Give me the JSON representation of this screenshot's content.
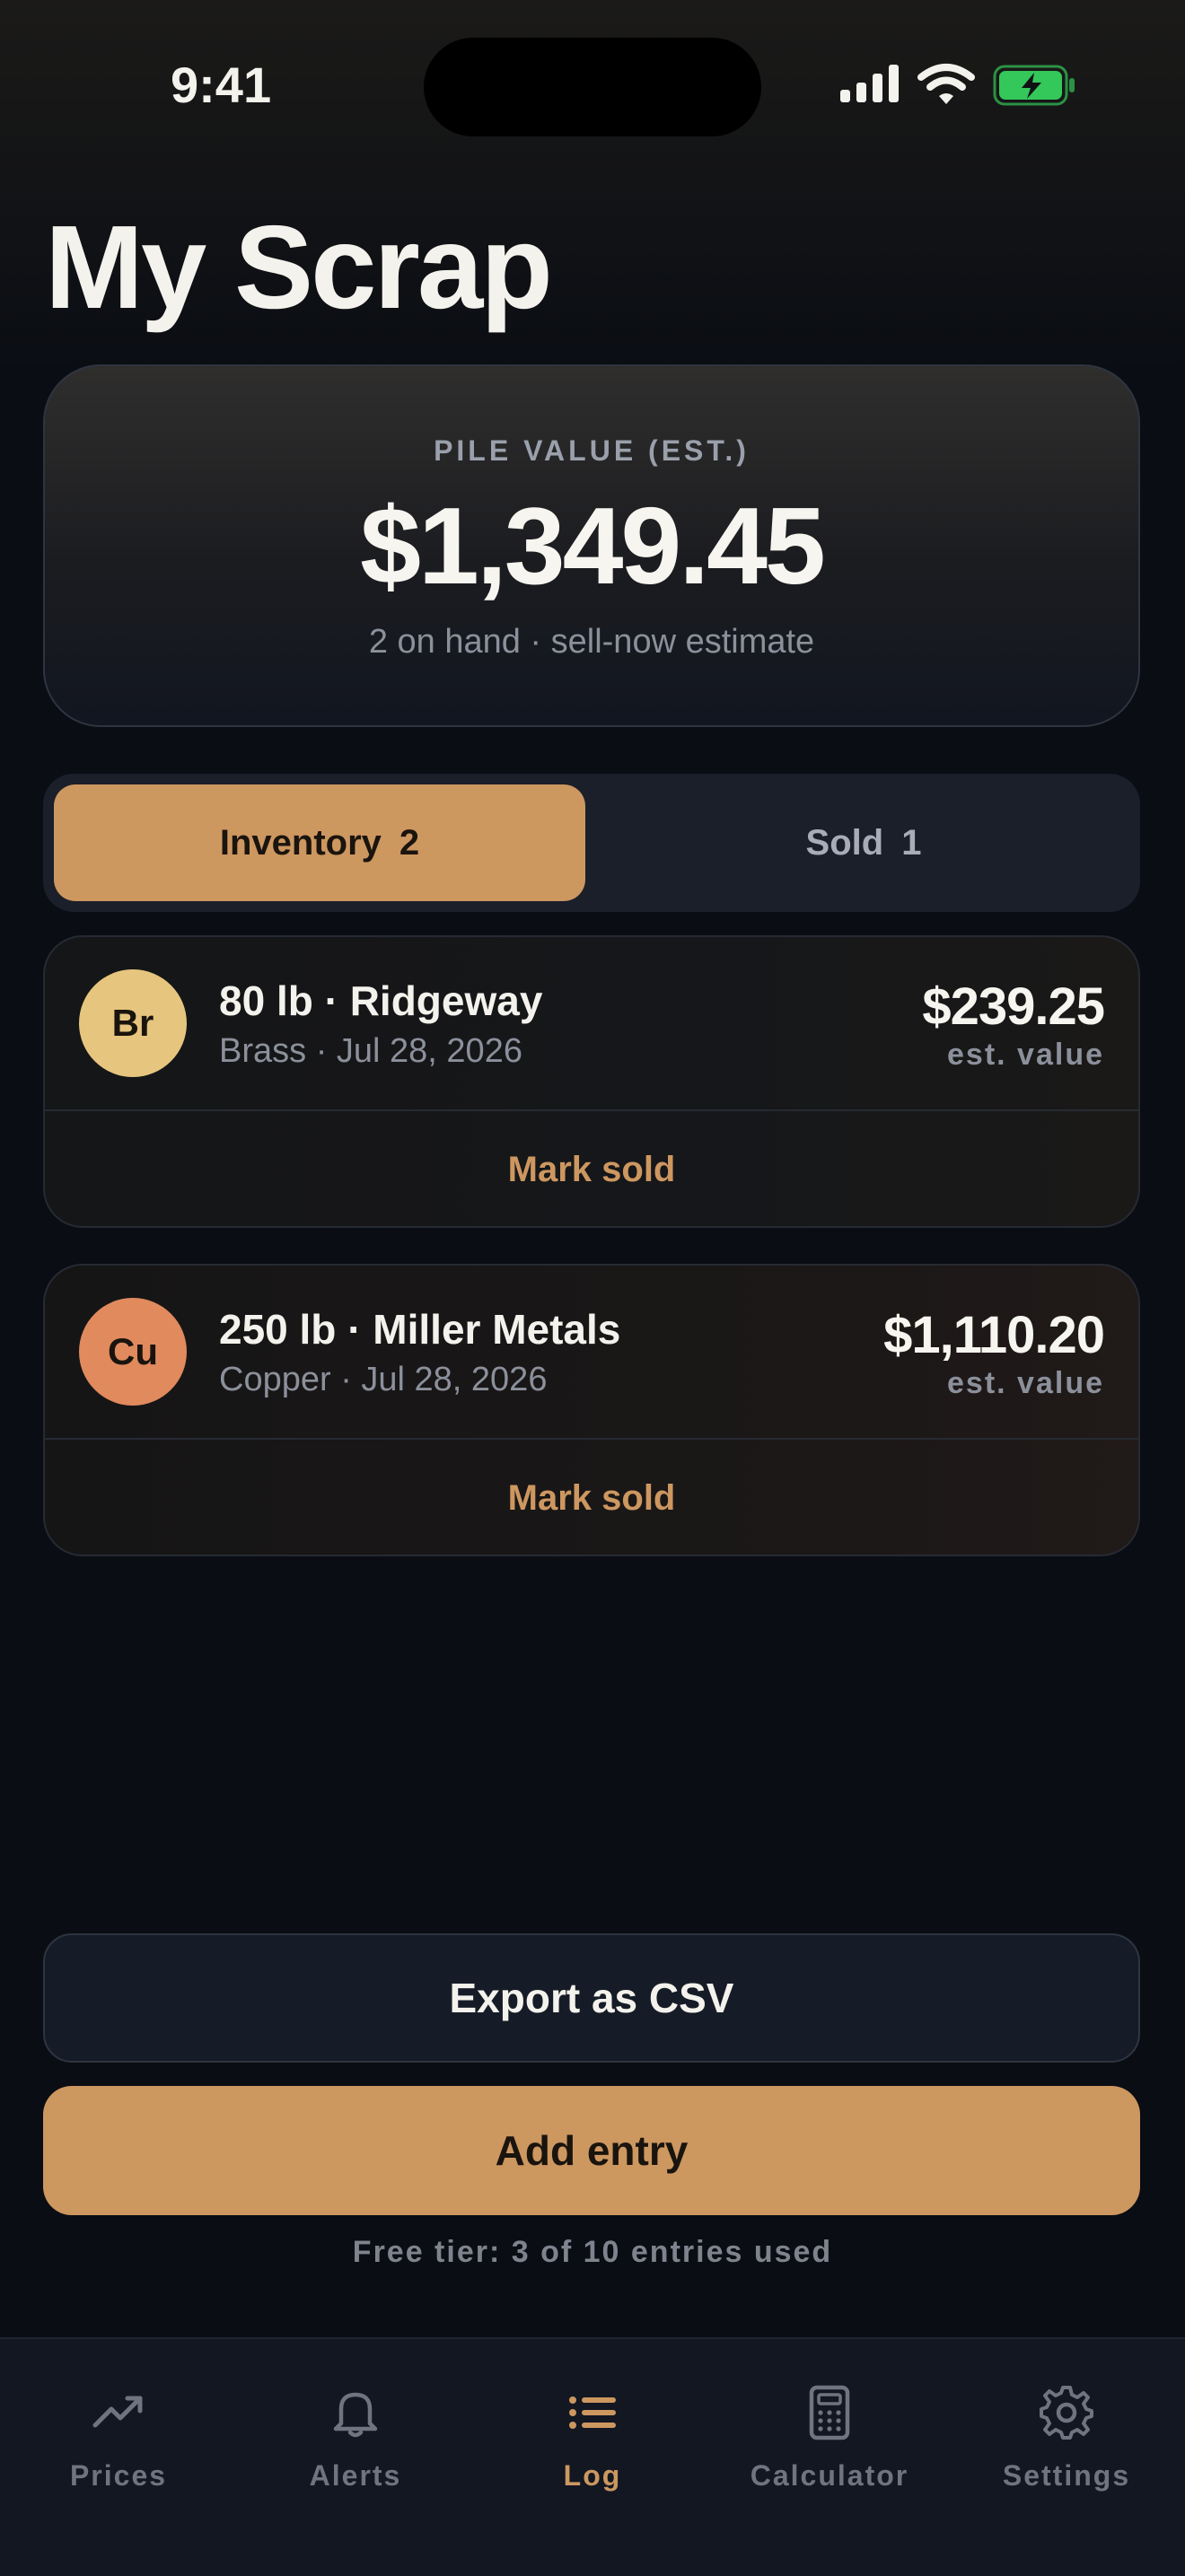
{
  "status_bar": {
    "time": "9:41"
  },
  "page": {
    "title": "My Scrap"
  },
  "pile": {
    "label": "PILE VALUE (EST.)",
    "value": "$1,349.45",
    "subtitle": "2 on hand · sell-now estimate"
  },
  "tabs_segment": {
    "inventory_label": "Inventory",
    "inventory_count": "2",
    "sold_label": "Sold",
    "sold_count": "1"
  },
  "items": [
    {
      "symbol": "Br",
      "title": "80 lb · Ridgeway",
      "subtitle": "Brass · Jul 28, 2026",
      "price": "$239.25",
      "price_note": "est. value",
      "action": "Mark sold",
      "color": "#e6c67e"
    },
    {
      "symbol": "Cu",
      "title": "250 lb · Miller Metals",
      "subtitle": "Copper · Jul 28, 2026",
      "price": "$1,110.20",
      "price_note": "est. value",
      "action": "Mark sold",
      "color": "#e08a5e"
    }
  ],
  "actions": {
    "export_label": "Export as CSV",
    "add_label": "Add entry",
    "free_tier_note": "Free tier: 3 of 10 entries used"
  },
  "tabbar": {
    "items": [
      {
        "label": "Prices",
        "icon": "trend-up-icon"
      },
      {
        "label": "Alerts",
        "icon": "bell-icon"
      },
      {
        "label": "Log",
        "icon": "list-icon"
      },
      {
        "label": "Calculator",
        "icon": "calculator-icon"
      },
      {
        "label": "Settings",
        "icon": "gear-icon"
      }
    ],
    "active_index": 2
  },
  "colors": {
    "accent": "#cd9760",
    "background": "#0a0d13",
    "battery": "#34c759"
  }
}
